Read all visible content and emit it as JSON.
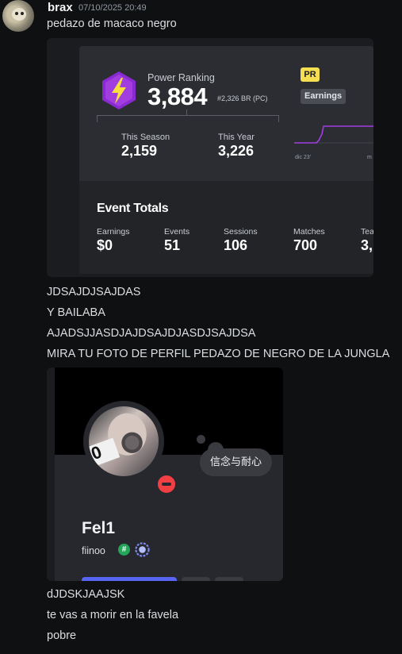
{
  "message": {
    "author": "brax",
    "timestamp": "07/10/2025 20:49",
    "lines_before": [
      "pedazo de macaco negro"
    ],
    "lines_middle": [
      "JDSAJDJSAJDAS",
      "Y BAILABA",
      "AJADSJJASDJAJDSAJDJASDJSAJDSA",
      "MIRA TU FOTO DE PERFIL PEDAZO DE NEGRO DE LA JUNGLA"
    ],
    "lines_after": [
      "dJDSKJAAJSK",
      "te vas a morir en la favela",
      "pobre"
    ]
  },
  "stats_embed": {
    "title": "Power Ranking",
    "value": "3,884",
    "rank": "#2,326 BR (PC)",
    "badge": "PR",
    "earnings_tag": "Earnings",
    "season_label": "This Season",
    "season_value": "2,159",
    "year_label": "This Year",
    "year_value": "3,226",
    "chart_tick_1": "dic 23'",
    "chart_tick_2": "m",
    "events_title": "Event Totals",
    "totals": [
      {
        "label": "Earnings",
        "value": "$0"
      },
      {
        "label": "Events",
        "value": "51"
      },
      {
        "label": "Sessions",
        "value": "106"
      },
      {
        "label": "Matches",
        "value": "700"
      },
      {
        "label": "Tea",
        "value": "3,"
      }
    ],
    "accent_color": "#a23de0"
  },
  "profile_embed": {
    "display_name": "Fel1",
    "handle": "fiinoo",
    "custom_status": "信念与耐心",
    "status": "dnd",
    "hash_badge": "#",
    "status_color": "#f23f43"
  }
}
